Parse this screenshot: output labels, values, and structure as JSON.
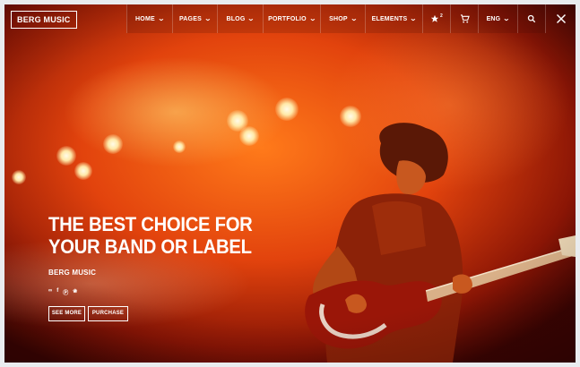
{
  "header": {
    "logo": "BERG MUSIC",
    "nav": [
      {
        "label": "HOME",
        "dropdown": true
      },
      {
        "label": "PAGES",
        "dropdown": true
      },
      {
        "label": "BLOG",
        "dropdown": true
      },
      {
        "label": "PORTFOLIO",
        "dropdown": true
      },
      {
        "label": "SHOP",
        "dropdown": true
      },
      {
        "label": "ELEMENTS",
        "dropdown": true
      }
    ],
    "icons": {
      "favorites": "star-icon",
      "cart": "cart-icon",
      "search": "search-icon",
      "close": "close-icon"
    },
    "language": "ENG",
    "favorites_count": "2"
  },
  "hero": {
    "title_line1": "THE BEST CHOICE FOR",
    "title_line2": "YOUR BAND OR LABEL",
    "subtitle": "BERG MUSIC",
    "social": [
      "lastfm-icon",
      "facebook-icon",
      "pinterest-icon",
      "twitter-icon"
    ],
    "buttons": {
      "primary": "SEE MORE",
      "secondary": "PURCHASE"
    }
  },
  "colors": {
    "accent": "#ff7a1a",
    "deep": "#8a1505",
    "text": "#ffffff"
  }
}
